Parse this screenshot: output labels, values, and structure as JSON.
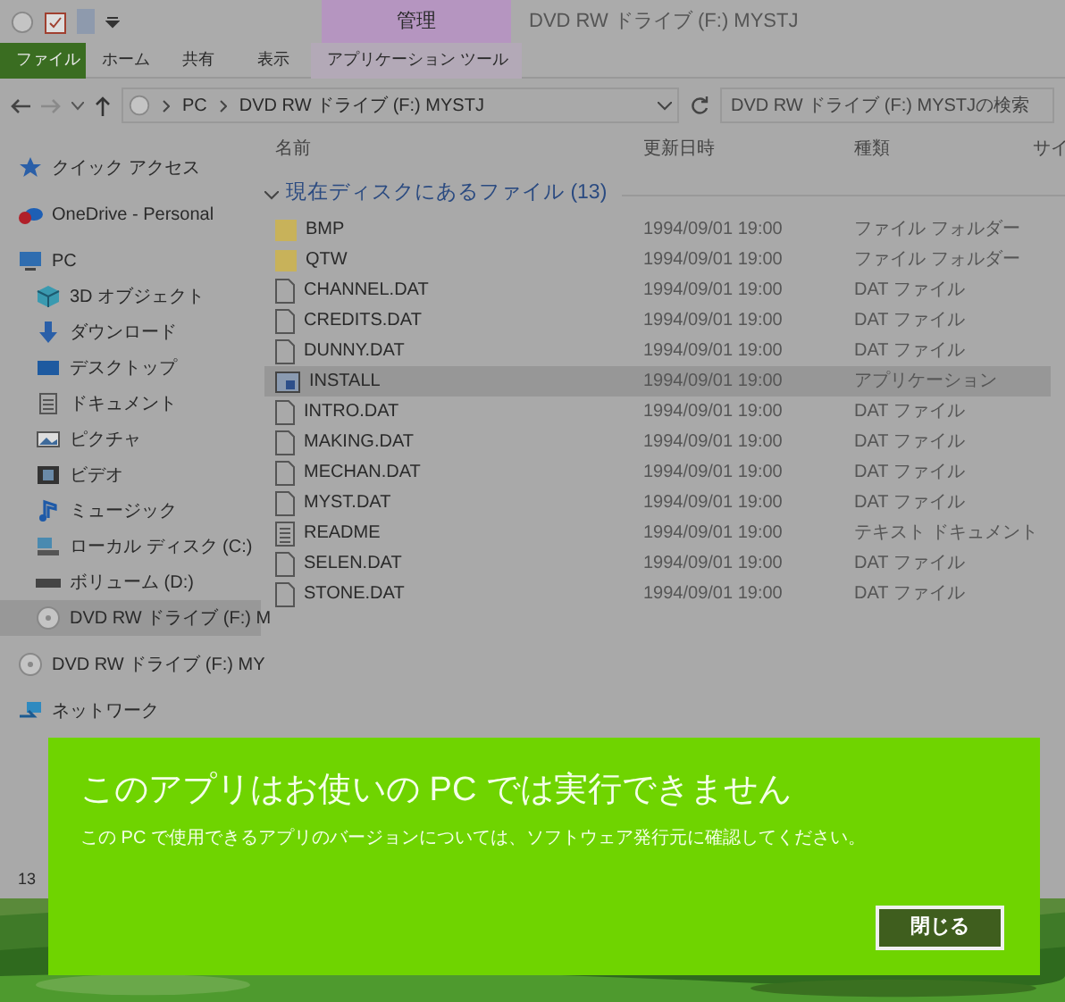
{
  "window": {
    "title": "DVD RW ドライブ (F:) MYSTJ",
    "context_tab_group": "管理"
  },
  "ribbon_tabs": [
    {
      "label": "ファイル",
      "selected": true
    },
    {
      "label": "ホーム",
      "selected": false
    },
    {
      "label": "共有",
      "selected": false
    },
    {
      "label": "表示",
      "selected": false
    },
    {
      "label": "アプリケーション ツール",
      "selected": false
    }
  ],
  "address_bar": {
    "path": [
      "PC",
      "DVD RW ドライブ (F:) MYSTJ"
    ]
  },
  "search": {
    "placeholder": "DVD RW ドライブ (F:) MYSTJの検索"
  },
  "sidebar": {
    "items": [
      {
        "label": "クイック アクセス",
        "kind": "star",
        "selected": false
      },
      {
        "label": "OneDrive - Personal",
        "kind": "cloud",
        "selected": false
      },
      {
        "label": "PC",
        "kind": "pc",
        "selected": false,
        "children": [
          {
            "label": "3D オブジェクト",
            "kind": "cube",
            "selected": false
          },
          {
            "label": "ダウンロード",
            "kind": "download",
            "selected": false
          },
          {
            "label": "デスクトップ",
            "kind": "desktop",
            "selected": false
          },
          {
            "label": "ドキュメント",
            "kind": "document",
            "selected": false
          },
          {
            "label": "ピクチャ",
            "kind": "pictures",
            "selected": false
          },
          {
            "label": "ビデオ",
            "kind": "video",
            "selected": false
          },
          {
            "label": "ミュージック",
            "kind": "music",
            "selected": false
          },
          {
            "label": "ローカル ディスク (C:)",
            "kind": "disk",
            "selected": false
          },
          {
            "label": "ボリューム (D:)",
            "kind": "volume",
            "selected": false
          },
          {
            "label": "DVD RW ドライブ (F:) M",
            "kind": "dvd",
            "selected": true
          }
        ]
      },
      {
        "label": "DVD RW ドライブ (F:) MY",
        "kind": "dvd",
        "selected": false
      },
      {
        "label": "ネットワーク",
        "kind": "network",
        "selected": false
      }
    ]
  },
  "table": {
    "columns": [
      "名前",
      "更新日時",
      "種類",
      "サイ"
    ],
    "group": "現在ディスクにあるファイル (13)",
    "rows": [
      {
        "name": "BMP",
        "date": "1994/09/01 19:00",
        "type": "ファイル フォルダー",
        "kind": "folder",
        "selected": false
      },
      {
        "name": "QTW",
        "date": "1994/09/01 19:00",
        "type": "ファイル フォルダー",
        "kind": "folder",
        "selected": false
      },
      {
        "name": "CHANNEL.DAT",
        "date": "1994/09/01 19:00",
        "type": "DAT ファイル",
        "kind": "file",
        "selected": false
      },
      {
        "name": "CREDITS.DAT",
        "date": "1994/09/01 19:00",
        "type": "DAT ファイル",
        "kind": "file",
        "selected": false
      },
      {
        "name": "DUNNY.DAT",
        "date": "1994/09/01 19:00",
        "type": "DAT ファイル",
        "kind": "file",
        "selected": false
      },
      {
        "name": "INSTALL",
        "date": "1994/09/01 19:00",
        "type": "アプリケーション",
        "kind": "app",
        "selected": true
      },
      {
        "name": "INTRO.DAT",
        "date": "1994/09/01 19:00",
        "type": "DAT ファイル",
        "kind": "file",
        "selected": false
      },
      {
        "name": "MAKING.DAT",
        "date": "1994/09/01 19:00",
        "type": "DAT ファイル",
        "kind": "file",
        "selected": false
      },
      {
        "name": "MECHAN.DAT",
        "date": "1994/09/01 19:00",
        "type": "DAT ファイル",
        "kind": "file",
        "selected": false
      },
      {
        "name": "MYST.DAT",
        "date": "1994/09/01 19:00",
        "type": "DAT ファイル",
        "kind": "file",
        "selected": false
      },
      {
        "name": "README",
        "date": "1994/09/01 19:00",
        "type": "テキスト ドキュメント",
        "kind": "text",
        "selected": false
      },
      {
        "name": "SELEN.DAT",
        "date": "1994/09/01 19:00",
        "type": "DAT ファイル",
        "kind": "file",
        "selected": false
      },
      {
        "name": "STONE.DAT",
        "date": "1994/09/01 19:00",
        "type": "DAT ファイル",
        "kind": "file",
        "selected": false
      }
    ]
  },
  "status_bar": "13",
  "dialog": {
    "title": "このアプリはお使いの PC では実行できません",
    "message": "この PC で使用できるアプリのバージョンについては、ソフトウェア発行元に確認してください。",
    "button": "閉じる"
  }
}
